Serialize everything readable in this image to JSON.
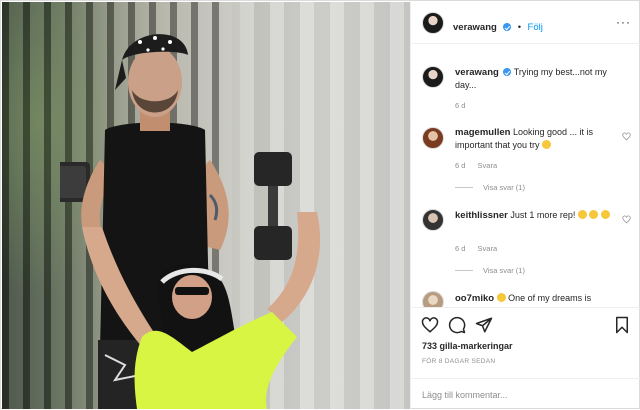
{
  "post": {
    "author": "verawang",
    "follow_label": "Följ",
    "more_label": "···"
  },
  "comments": [
    {
      "user": "verawang",
      "text": "Trying my best...not my day...",
      "age": "6 d",
      "reply_label": "",
      "view_replies": ""
    },
    {
      "user": "magemullen",
      "text": "Looking good ... it is important that you try",
      "age": "6 d",
      "reply_label": "Svara",
      "view_replies": "Visa svar (1)"
    },
    {
      "user": "keithlissner",
      "text": "Just 1 more rep!",
      "age": "6 d",
      "reply_label": "Svara",
      "view_replies": "Visa svar (1)"
    },
    {
      "user": "oo7miko",
      "text": "One of my dreams is",
      "age": "",
      "reply_label": "",
      "view_replies": ""
    }
  ],
  "actions": {
    "icons": [
      "heart-icon",
      "comment-icon",
      "share-icon",
      "bookmark-icon"
    ],
    "likes": "733 gilla-markeringar",
    "time_ago": "FÖR 8 DAGAR SEDAN"
  },
  "add_comment": {
    "placeholder": "Lägg till kommentar..."
  },
  "colors": {
    "accent": "#0095f6",
    "verified": "#3897f0",
    "muted": "#8e8e8e",
    "text": "#262626",
    "shirt_neon": "#d7f542"
  }
}
